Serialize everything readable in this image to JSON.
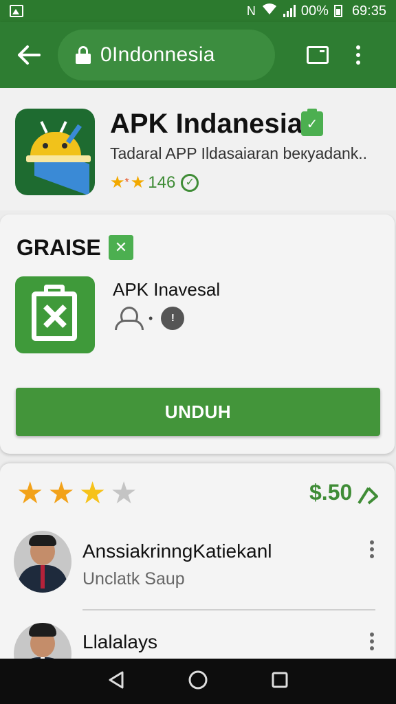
{
  "status_bar": {
    "battery": "00%",
    "time": "69:35"
  },
  "browser": {
    "url": "0Indonnesia"
  },
  "app": {
    "title": "APK Indanesia",
    "subtitle": "Tadaral APP Ildasaiaran beкyadank..",
    "rating_count": "146"
  },
  "section": {
    "title": "GRAISE",
    "item_name": "APK Inavesal",
    "download_label": "UNDUH"
  },
  "reviews": {
    "rating": 3,
    "price": "$.50",
    "items": [
      {
        "name": "AnssiakrinngKatiekanl",
        "text": "Unclatk  Saup"
      },
      {
        "name": "Llalalays",
        "text": ""
      }
    ]
  },
  "colors": {
    "brand_green": "#2e7d32",
    "accent_green": "#43953a",
    "star": "#f2a21a"
  }
}
